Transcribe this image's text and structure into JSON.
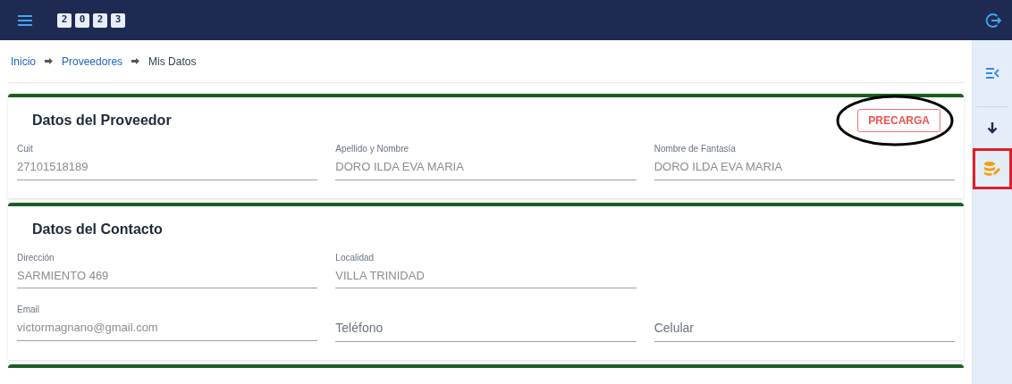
{
  "header": {
    "logo_digits": [
      "2",
      "0",
      "2",
      "3"
    ]
  },
  "breadcrumb": [
    {
      "label": "Inicio",
      "link": true
    },
    {
      "label": "Proveedores",
      "link": true
    },
    {
      "label": "Mis Datos",
      "link": false
    }
  ],
  "sections": [
    {
      "title": "Datos del Proveedor",
      "button": {
        "label": "PRECARGA",
        "annotated": true
      },
      "rows": [
        [
          {
            "label": "Cuit",
            "value": "27101518189"
          },
          {
            "label": "Apellido y Nombre",
            "value": "DORO ILDA EVA MARIA"
          },
          {
            "label": "Nombre de Fantasía",
            "value": "DORO ILDA EVA MARIA"
          }
        ]
      ]
    },
    {
      "title": "Datos del Contacto",
      "rows": [
        [
          {
            "label": "Dirección",
            "value": "SARMIENTO 469"
          },
          {
            "label": "Localidad",
            "value": "VILLA TRINIDAD"
          }
        ],
        [
          {
            "label": "Email",
            "value": "victormagnano@gmail.com"
          },
          {
            "placeholder": "Teléfono"
          },
          {
            "placeholder": "Celular"
          }
        ]
      ]
    }
  ],
  "sidebar": {
    "items": [
      {
        "kind": "collapse",
        "annotated": false
      },
      {
        "kind": "download",
        "annotated": false
      },
      {
        "kind": "database-edit",
        "annotated": true
      }
    ]
  }
}
